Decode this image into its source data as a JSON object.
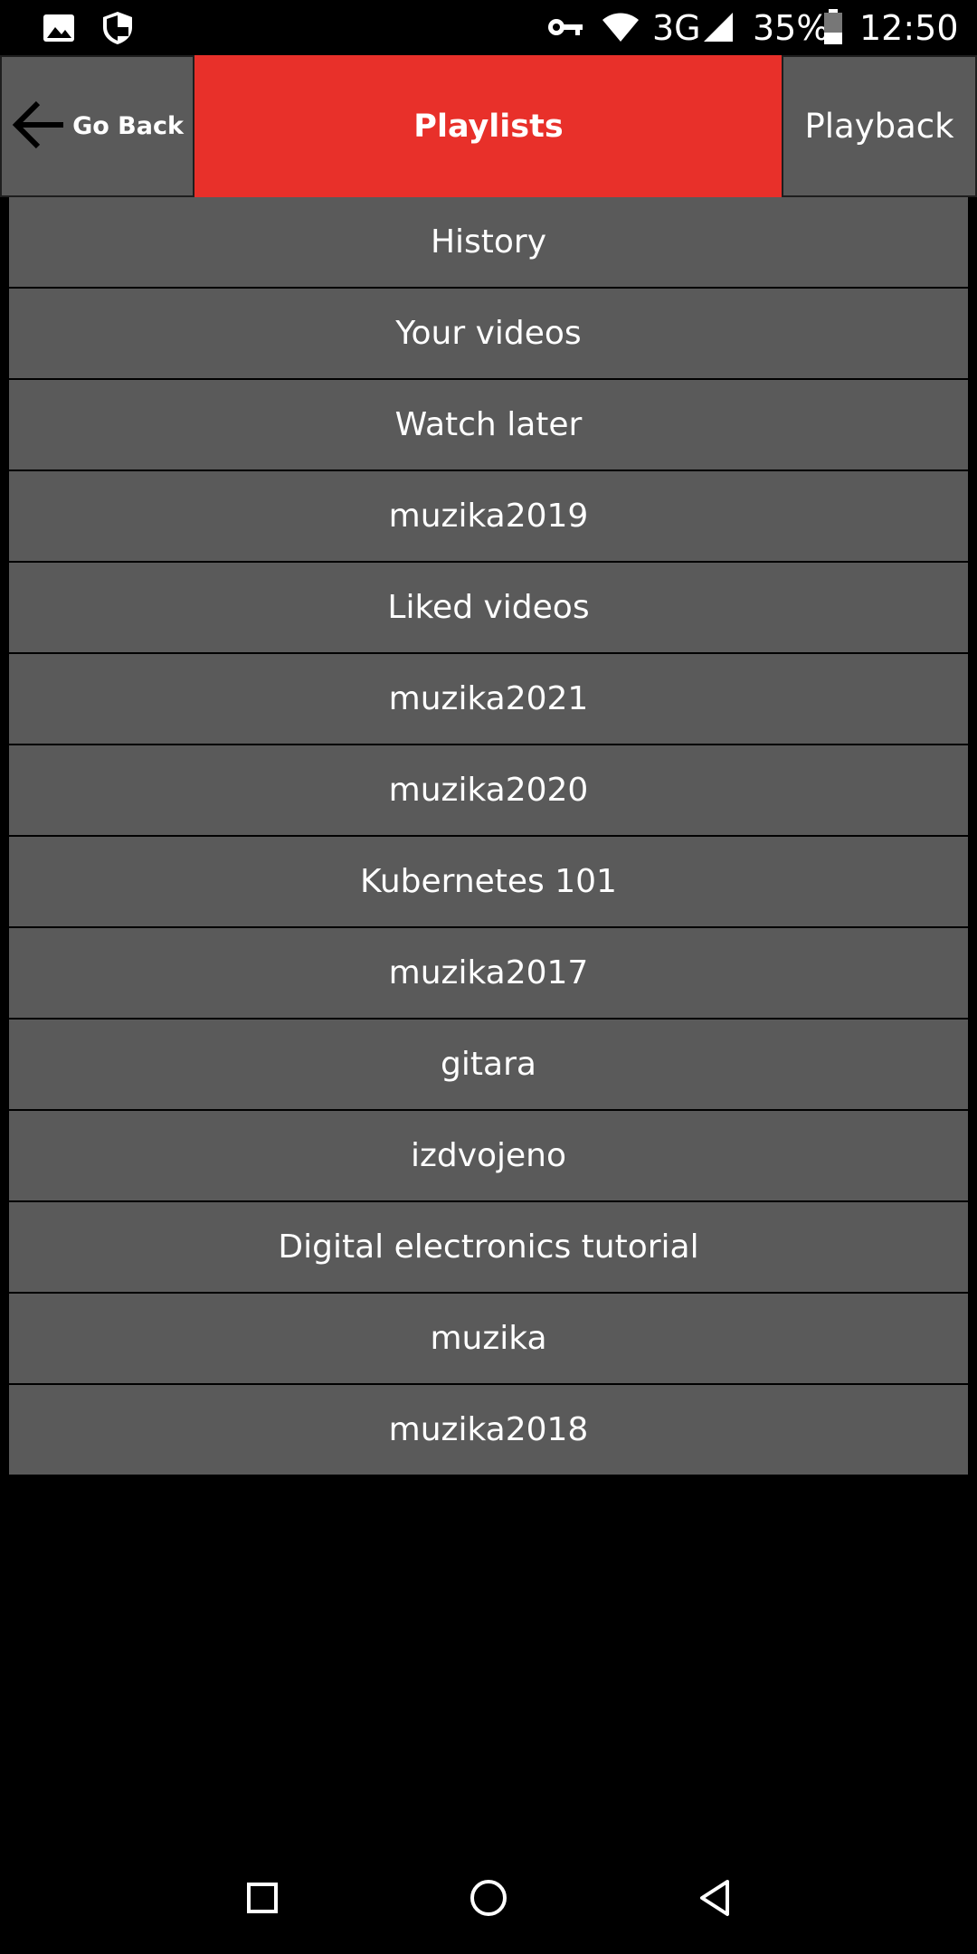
{
  "status_bar": {
    "battery": "35%",
    "network": "3G",
    "time": "12:50",
    "icons": [
      "image-icon",
      "shield-icon",
      "key-icon",
      "wifi-icon",
      "signal-icon",
      "battery-icon"
    ]
  },
  "header": {
    "back_label": "Go Back",
    "title": "Playlists",
    "playback_label": "Playback",
    "title_color": "#e8302a",
    "button_color": "#5a5a5a"
  },
  "playlists": [
    "History",
    "Your videos",
    "Watch later",
    "muzika2019",
    "Liked videos",
    "muzika2021",
    "muzika2020",
    "Kubernetes 101",
    "muzika2017",
    "gitara",
    "izdvojeno",
    "Digital electronics tutorial",
    "muzika",
    "muzika2018"
  ],
  "nav_bar": {
    "icons": [
      "recents-icon",
      "home-icon",
      "back-icon"
    ]
  }
}
